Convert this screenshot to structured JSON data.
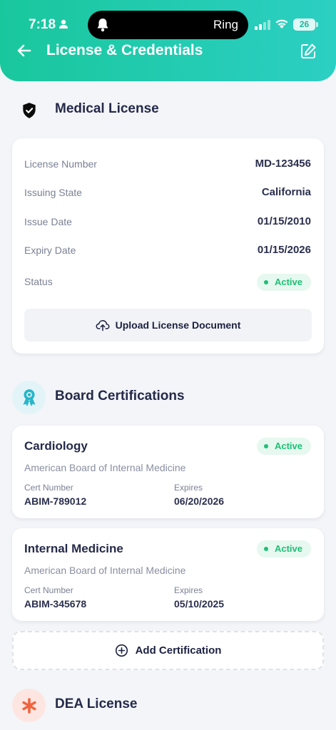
{
  "status_bar": {
    "time": "7:18",
    "island_text": "Ring",
    "battery": "26"
  },
  "header": {
    "title": "License & Credentials"
  },
  "medical_license": {
    "section_title": "Medical License",
    "rows": [
      {
        "label": "License Number",
        "value": "MD-123456"
      },
      {
        "label": "Issuing State",
        "value": "California"
      },
      {
        "label": "Issue Date",
        "value": "01/15/2010"
      },
      {
        "label": "Expiry Date",
        "value": "01/15/2026"
      }
    ],
    "status_label": "Status",
    "status_value": "Active",
    "upload_label": "Upload License Document"
  },
  "board_certifications": {
    "section_title": "Board Certifications",
    "certs": [
      {
        "name": "Cardiology",
        "status": "Active",
        "board": "American Board of Internal Medicine",
        "cert_number_label": "Cert Number",
        "cert_number": "ABIM-789012",
        "expires_label": "Expires",
        "expires": "06/20/2026"
      },
      {
        "name": "Internal Medicine",
        "status": "Active",
        "board": "American Board of Internal Medicine",
        "cert_number_label": "Cert Number",
        "cert_number": "ABIM-345678",
        "expires_label": "Expires",
        "expires": "05/10/2025"
      }
    ],
    "add_label": "Add Certification"
  },
  "dea_license": {
    "section_title": "DEA License"
  },
  "colors": {
    "header_gradient_start": "#19c79d",
    "header_gradient_end": "#2ccfc3",
    "active_green": "#1ebf76",
    "active_bg": "#e6f8ef",
    "board_icon_bg": "#e3f4f8",
    "board_icon": "#27b6c9",
    "dea_icon_bg": "#fde6e1",
    "dea_icon": "#f0643f"
  },
  "icons": {
    "back": "arrow-left-icon",
    "edit": "edit-icon",
    "medical_license": "shield-check-icon",
    "board": "award-ribbon-icon",
    "dea": "asterisk-icon",
    "upload": "cloud-upload-icon",
    "add": "plus-circle-icon"
  }
}
